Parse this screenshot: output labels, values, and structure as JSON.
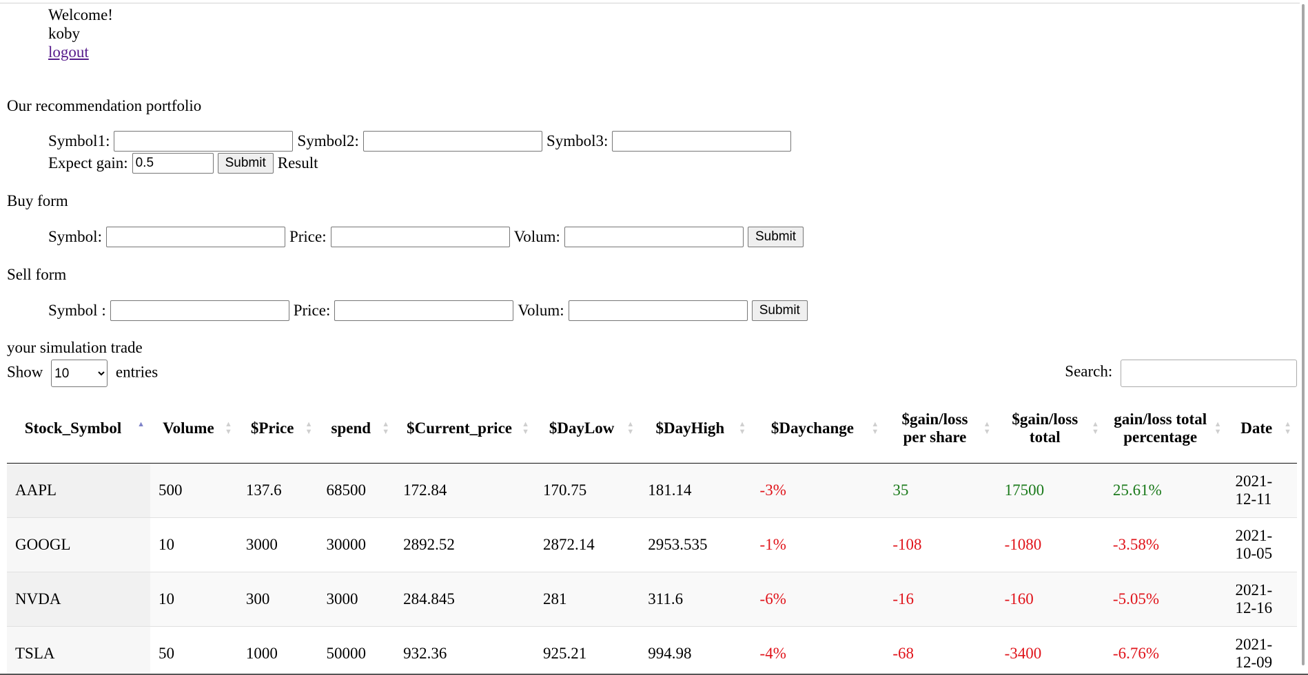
{
  "header": {
    "welcome": "Welcome!",
    "username": "koby",
    "logout": "logout"
  },
  "recommendation": {
    "title": "Our recommendation portfolio",
    "symbol1_label": "Symbol1:",
    "symbol2_label": "Symbol2:",
    "symbol3_label": "Symbol3:",
    "gain_label": "Expect gain:",
    "gain_value": "0.5",
    "submit": "Submit",
    "result": "Result"
  },
  "buy": {
    "title": "Buy form",
    "symbol_label": "Symbol:",
    "price_label": "Price:",
    "volume_label": "Volum:",
    "submit": "Submit"
  },
  "sell": {
    "title": "Sell form",
    "symbol_label": "Symbol :",
    "price_label": "Price:",
    "volume_label": "Volum:",
    "submit": "Submit"
  },
  "trades": {
    "title": "your simulation trade",
    "show_label": "Show",
    "entries_value": "10",
    "entries_label": "entries",
    "search_label": "Search:",
    "columns": [
      "Stock_Symbol",
      "Volume",
      "$Price",
      "spend",
      "$Current_price",
      "$DayLow",
      "$DayHigh",
      "$Daychange",
      "$gain/loss per share",
      "$gain/loss total",
      "gain/loss total percentage",
      "Date"
    ],
    "rows": [
      {
        "symbol": "AAPL",
        "volume": "500",
        "price": "137.6",
        "spend": "68500",
        "current": "172.84",
        "low": "170.75",
        "high": "181.14",
        "daychange": "-3%",
        "gain_share": "35",
        "gain_total": "17500",
        "gain_pct": "25.61%",
        "date": "2021-12-11"
      },
      {
        "symbol": "GOOGL",
        "volume": "10",
        "price": "3000",
        "spend": "30000",
        "current": "2892.52",
        "low": "2872.14",
        "high": "2953.535",
        "daychange": "-1%",
        "gain_share": "-108",
        "gain_total": "-1080",
        "gain_pct": "-3.58%",
        "date": "2021-10-05"
      },
      {
        "symbol": "NVDA",
        "volume": "10",
        "price": "300",
        "spend": "3000",
        "current": "284.845",
        "low": "281",
        "high": "311.6",
        "daychange": "-6%",
        "gain_share": "-16",
        "gain_total": "-160",
        "gain_pct": "-5.05%",
        "date": "2021-12-16"
      },
      {
        "symbol": "TSLA",
        "volume": "50",
        "price": "1000",
        "spend": "50000",
        "current": "932.36",
        "low": "925.21",
        "high": "994.98",
        "daychange": "-4%",
        "gain_share": "-68",
        "gain_total": "-3400",
        "gain_pct": "-6.76%",
        "date": "2021-12-09"
      }
    ]
  },
  "colors": {
    "negative": "#e0131a",
    "positive": "#1b7a1b",
    "link": "#551a8b",
    "sort_active": "#7f84c9"
  }
}
